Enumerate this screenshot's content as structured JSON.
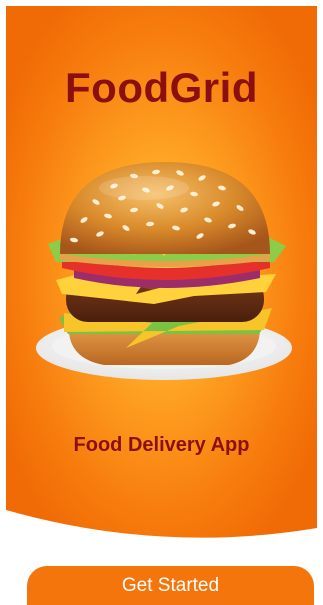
{
  "app": {
    "title": "FoodGrid",
    "subtitle": "Food Delivery App"
  },
  "actions": {
    "get_started_label": "Get Started"
  },
  "colors": {
    "primary": "#f4750b",
    "title_text": "#8b0f0f",
    "button_text": "#ffffff",
    "background": "#ffffff"
  },
  "illustration": {
    "name": "burger-illustration"
  }
}
